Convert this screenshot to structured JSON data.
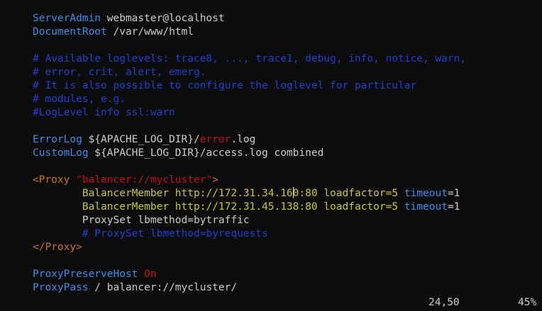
{
  "editor": {
    "lines": [
      [
        {
          "t": "ServerAdmin",
          "c": "key"
        },
        {
          "t": " webmaster@localhost",
          "c": "text"
        }
      ],
      [
        {
          "t": "DocumentRoot",
          "c": "key"
        },
        {
          "t": " /var/www/html",
          "c": "text"
        }
      ],
      [],
      [
        {
          "t": "# Available loglevels: trace8, ..., trace1, debug, info, notice, warn,",
          "c": "com"
        }
      ],
      [
        {
          "t": "# error, crit, alert, emerg.",
          "c": "com"
        }
      ],
      [
        {
          "t": "# It is also possible to configure the loglevel for particular",
          "c": "com"
        }
      ],
      [
        {
          "t": "# modules, e.g.",
          "c": "com"
        }
      ],
      [
        {
          "t": "#LogLevel info ssl:warn",
          "c": "com"
        }
      ],
      [],
      [
        {
          "t": "ErrorLog",
          "c": "key"
        },
        {
          "t": " ${APACHE_LOG_DIR}/",
          "c": "text"
        },
        {
          "t": "error",
          "c": "red"
        },
        {
          "t": ".log",
          "c": "text"
        }
      ],
      [
        {
          "t": "CustomLog",
          "c": "key"
        },
        {
          "t": " ${APACHE_LOG_DIR}/access.log combined",
          "c": "text"
        }
      ],
      [],
      [
        {
          "t": "<Proxy",
          "c": "tag"
        },
        {
          "t": " ",
          "c": "text"
        },
        {
          "t": "\"balancer://mycluster\"",
          "c": "str"
        },
        {
          "t": ">",
          "c": "tag"
        }
      ],
      [
        {
          "t": "        ",
          "c": "text"
        },
        {
          "t": "BalancerMember",
          "c": "yellow"
        },
        {
          "t": " ",
          "c": "text"
        },
        {
          "t": "http://172.31.34.16",
          "c": "yellow"
        },
        {
          "t": "",
          "c": "cursor"
        },
        {
          "t": "0:80",
          "c": "yellow"
        },
        {
          "t": " ",
          "c": "text"
        },
        {
          "t": "loadfactor=5",
          "c": "yellow"
        },
        {
          "t": " ",
          "c": "text"
        },
        {
          "t": "timeout",
          "c": "blue"
        },
        {
          "t": "=1",
          "c": "text"
        }
      ],
      [
        {
          "t": "        ",
          "c": "text"
        },
        {
          "t": "BalancerMember",
          "c": "yellow"
        },
        {
          "t": " ",
          "c": "text"
        },
        {
          "t": "http://172.31.45.138:80",
          "c": "yellow"
        },
        {
          "t": " ",
          "c": "text"
        },
        {
          "t": "loadfactor=5",
          "c": "yellow"
        },
        {
          "t": " ",
          "c": "text"
        },
        {
          "t": "timeout",
          "c": "blue"
        },
        {
          "t": "=1",
          "c": "text"
        }
      ],
      [
        {
          "t": "        ProxySet lbmethod=bytraffic",
          "c": "text"
        }
      ],
      [
        {
          "t": "        ",
          "c": "text"
        },
        {
          "t": "# ProxySet lbmethod=byrequests",
          "c": "com"
        }
      ],
      [
        {
          "t": "</Proxy>",
          "c": "tag"
        }
      ],
      [],
      [
        {
          "t": "ProxyPreserveHost",
          "c": "key"
        },
        {
          "t": " ",
          "c": "text"
        },
        {
          "t": "On",
          "c": "red"
        }
      ],
      [
        {
          "t": "ProxyPass",
          "c": "key"
        },
        {
          "t": " / balancer://mycluster/",
          "c": "text"
        }
      ]
    ]
  },
  "status": {
    "position": "24,50",
    "percent": "45%"
  },
  "colors": {
    "background": "#0c0c0c",
    "keyword": "#3b8eea",
    "comment": "#1f3fd0",
    "error_red": "#c50f1f",
    "tag_orange": "#c7731c",
    "yellow": "#c9c92a",
    "text": "#cccccc"
  }
}
